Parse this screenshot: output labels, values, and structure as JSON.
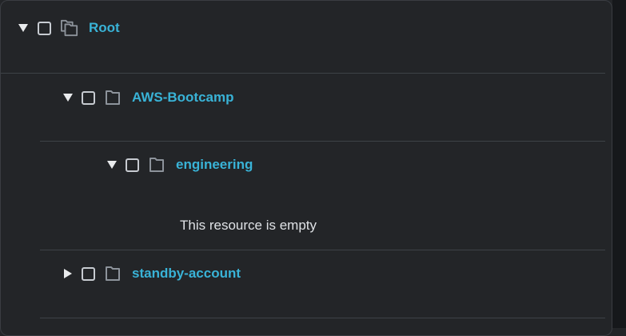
{
  "tree": {
    "root": {
      "label": "Root",
      "expanded": true,
      "icon": "folder-stack-icon"
    },
    "aws_bootcamp": {
      "label": "AWS-Bootcamp",
      "expanded": true,
      "icon": "folder-icon"
    },
    "engineering": {
      "label": "engineering",
      "expanded": true,
      "icon": "folder-icon",
      "empty_message": "This resource is empty"
    },
    "standby_account": {
      "label": "standby-account",
      "expanded": false,
      "icon": "folder-icon"
    }
  },
  "colors": {
    "background": "#232528",
    "link": "#39b3d7",
    "divider": "#3e4247",
    "checkbox_border": "#c7cbd1",
    "icon": "#8d939b"
  }
}
